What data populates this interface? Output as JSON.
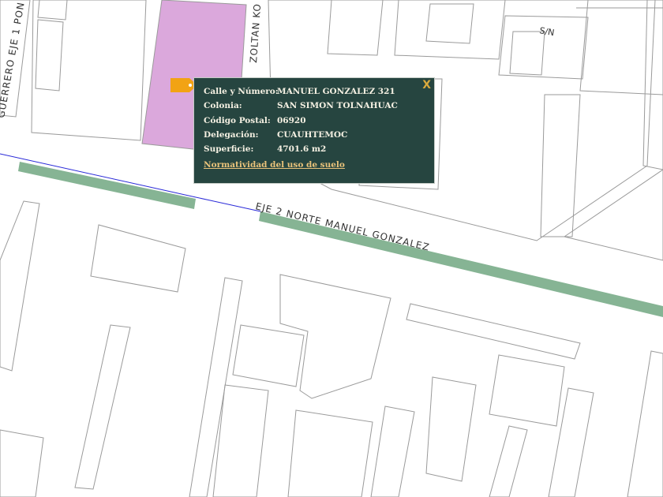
{
  "map": {
    "street_labels": {
      "eje2": "EJE 2 NORTE MANUEL GONZALEZ",
      "zoltan": "ZOLTAN KO",
      "guerrero": "GUERRERO EJE 1 PON",
      "sn": "S/N"
    },
    "colors": {
      "background": "#ffffff",
      "block_outline": "#9a9a9a",
      "selected_lot": "#dba8dc",
      "green_strip": "#86b494",
      "boundary_line": "#2a2ad8",
      "marker": "#f2a314",
      "popup_bg": "#264540"
    }
  },
  "marker": {
    "icon": "price-tag-icon"
  },
  "popup": {
    "rows": [
      {
        "label": "Calle y Número:",
        "value": "MANUEL GONZALEZ 321"
      },
      {
        "label": "Colonia:",
        "value": "SAN SIMON TOLNAHUAC"
      },
      {
        "label": "Código Postal:",
        "value": "06920"
      },
      {
        "label": "Delegación:",
        "value": "CUAUHTEMOC"
      },
      {
        "label": "Superficie:",
        "value": "4701.6 m2"
      }
    ],
    "link": "Normatividad del uso de suelo",
    "close": "X"
  }
}
